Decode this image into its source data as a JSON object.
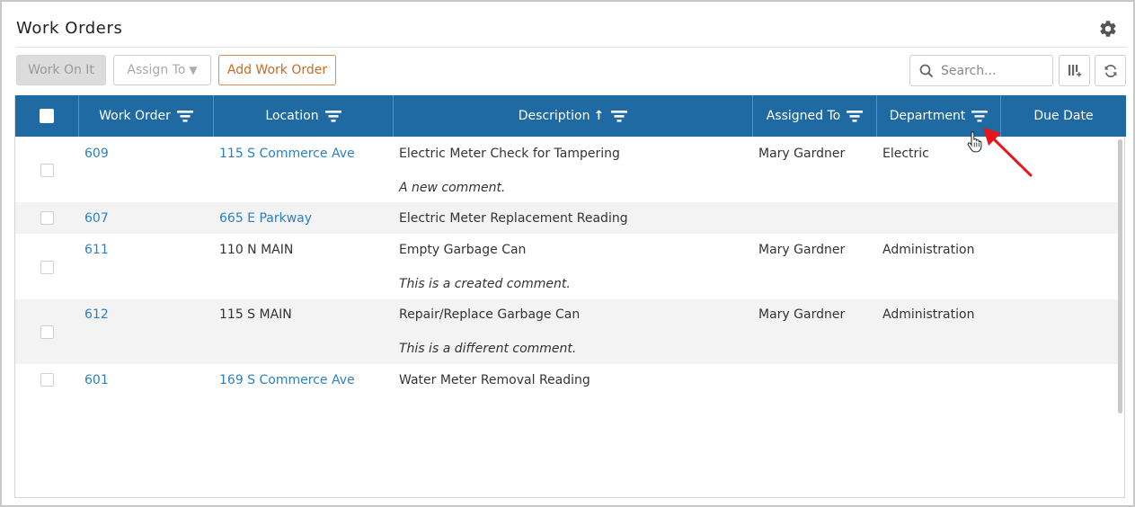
{
  "page": {
    "title": "Work Orders"
  },
  "toolbar": {
    "work_on_it": "Work On It",
    "assign_to": "Assign To",
    "add_work_order": "Add Work Order",
    "search_placeholder": "Search..."
  },
  "icons": {
    "settings": "gear-icon",
    "search": "search-icon",
    "columns": "add-column-icon",
    "refresh": "refresh-icon",
    "filter": "filter-icon",
    "sort": "sort-ascending-icon"
  },
  "colors": {
    "header_bg": "#1f6aa2",
    "link": "#2d7fc1",
    "add_button": "#c96a25",
    "annotation_arrow": "#e8161c"
  },
  "table": {
    "columns": [
      {
        "key": "select",
        "label": ""
      },
      {
        "key": "work_order",
        "label": "Work Order"
      },
      {
        "key": "location",
        "label": "Location"
      },
      {
        "key": "description",
        "label": "Description"
      },
      {
        "key": "assigned_to",
        "label": "Assigned To"
      },
      {
        "key": "department",
        "label": "Department"
      },
      {
        "key": "due_date",
        "label": "Due Date"
      }
    ],
    "sort": {
      "column": "description",
      "direction": "ascending"
    },
    "rows": [
      {
        "work_order": "609",
        "location": "115 S Commerce Ave",
        "location_link": true,
        "description": "Electric Meter Check for Tampering",
        "comment": "A new comment.",
        "assigned_to": "Mary Gardner",
        "department": "Electric",
        "due_date": ""
      },
      {
        "work_order": "607",
        "location": "665 E Parkway",
        "location_link": true,
        "description": "Electric Meter Replacement Reading",
        "comment": "",
        "assigned_to": "",
        "department": "",
        "due_date": ""
      },
      {
        "work_order": "611",
        "location": "110 N MAIN",
        "location_link": false,
        "description": "Empty Garbage Can",
        "comment": "This is a created comment.",
        "assigned_to": "Mary Gardner",
        "department": "Administration",
        "due_date": ""
      },
      {
        "work_order": "612",
        "location": "115 S MAIN",
        "location_link": false,
        "description": "Repair/Replace Garbage Can",
        "comment": "This is a different comment.",
        "assigned_to": "Mary Gardner",
        "department": "Administration",
        "due_date": ""
      },
      {
        "work_order": "601",
        "location": "169 S Commerce Ave",
        "location_link": true,
        "description": "Water Meter Removal Reading",
        "comment": "",
        "assigned_to": "",
        "department": "",
        "due_date": ""
      }
    ]
  }
}
